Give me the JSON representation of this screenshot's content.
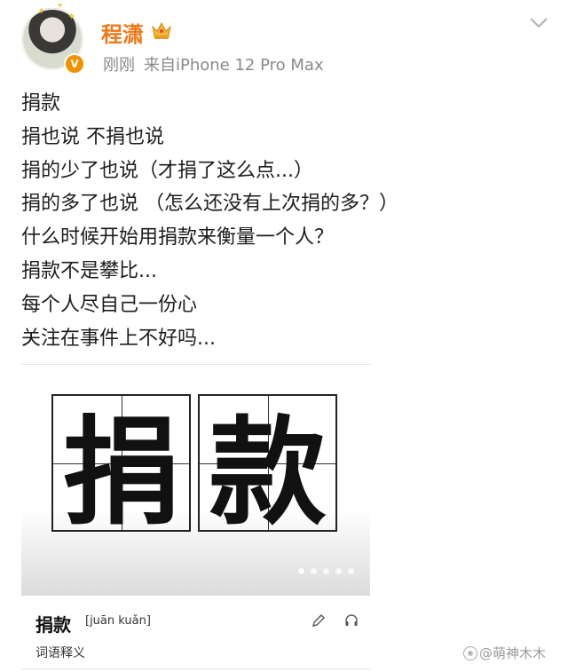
{
  "profile": {
    "name": "程潇",
    "time": "刚刚",
    "source": "来自iPhone 12 Pro Max",
    "verified_mark": "V"
  },
  "post": {
    "lines": [
      "捐款",
      "捐也说 不捐也说",
      "捐的少了也说（才捐了这么点...）",
      "捐的多了也说 （怎么还没有上次捐的多？）",
      "什么时候开始用捐款来衡量一个人？",
      "捐款不是攀比...",
      "每个人尽自己一份心",
      "关注在事件上不好吗..."
    ]
  },
  "card": {
    "char1": "捐",
    "char2": "款",
    "slide_index": 1,
    "slide_count": 5
  },
  "dictionary": {
    "word": "捐款",
    "pinyin": "[juān kuǎn]",
    "subtitle": "词语释义"
  },
  "watermark": {
    "text": "@萌神木木"
  },
  "icons": {
    "crown": "crown-icon",
    "menu": "chevron-down-icon",
    "edit": "pencil-icon",
    "audio": "headphone-icon"
  },
  "colors": {
    "username": "#ea7a1c",
    "verified": "#f29100",
    "meta": "#8a8a8a"
  }
}
